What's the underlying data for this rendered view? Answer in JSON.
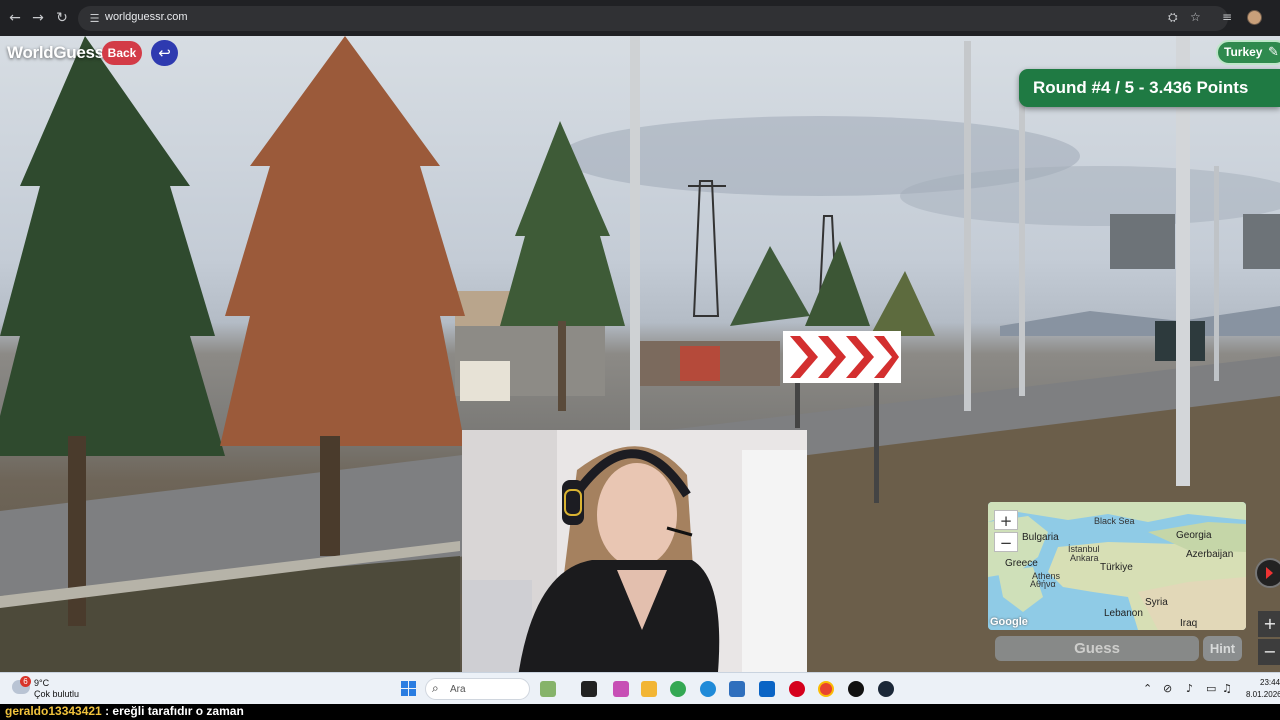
{
  "browser": {
    "url": "worldguessr.com",
    "nav_icons": [
      "back-arrow-icon",
      "forward-arrow-icon",
      "reload-icon"
    ],
    "right_icons": [
      "translate-icon",
      "bookmark-star-icon",
      "tab-search-icon",
      "profile-avatar"
    ]
  },
  "game": {
    "logo": "WorldGuessr",
    "back_label": "Back",
    "country_label": "Turkey",
    "round_banner": "Round #4 / 5 - 3.436 Points",
    "guess_label": "Guess",
    "hint_label": "Hint",
    "zoom_in": "+",
    "zoom_out": "−"
  },
  "minimap": {
    "labels": {
      "black_sea": "Black Sea",
      "bulgaria": "Bulgaria",
      "georgia": "Georgia",
      "istanbul": "İstanbul",
      "azerbaijan": "Azerbaijan",
      "ankara": "Ankara",
      "greece": "Greece",
      "turkiye": "Türkiye",
      "athens": "Athens",
      "athens_local": "Αθήνα",
      "syria": "Syria",
      "lebanon": "Lebanon",
      "iraq": "Iraq",
      "google": "Google"
    }
  },
  "side_controls": {
    "plus": "+",
    "minus": "−"
  },
  "taskbar": {
    "weather_badge": "6",
    "weather_temp": "9°C",
    "weather_desc": "Çok bulutlu",
    "search_placeholder": "Ara",
    "clock_time": "23:44",
    "clock_date": "8.01.2026"
  },
  "chat": {
    "user": "geraldo13343421",
    "message": " : ereğli tarafıdır o zaman"
  },
  "colors": {
    "country_pill": "#2f8a4e",
    "round_banner": "#1f7a43",
    "back_button": "#d33b47",
    "undo_button": "#2e3ab0",
    "chat_user": "#f0c23c"
  }
}
